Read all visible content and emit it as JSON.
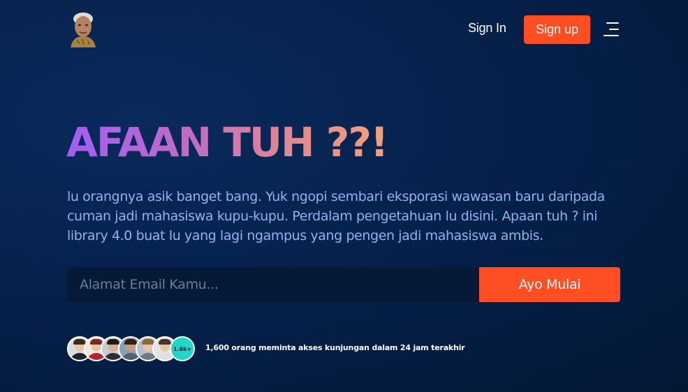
{
  "nav": {
    "signin_label": "Sign In",
    "signup_label": "Sign up",
    "logo_icon": "portrait-logo-icon",
    "menu_icon": "hamburger-menu-icon"
  },
  "hero": {
    "title": "AFAAN TUH ??!",
    "description": "lu orangnya asik banget bang. Yuk ngopi sembari eksporasi wawasan baru daripada cuman jadi mahasiswa kupu-kupu. Perdalam pengetahuan lu disini. Apaan tuh ? ini library 4.0 buat lu yang lagi ngampus yang pengen jadi mahasiswa ambis."
  },
  "signup_form": {
    "email_placeholder": "Alamat Email Kamu...",
    "email_value": "",
    "cta_label": "Ayo Mulai"
  },
  "social_proof": {
    "count_badge": "1.6k+",
    "text": "1,600 orang meminta akses kunjungan dalam 24 jam terakhir"
  },
  "colors": {
    "accent": "#ff4d24",
    "background": "#051f48",
    "description_text": "#8fb4f0",
    "badge": "#1fd8c8"
  }
}
